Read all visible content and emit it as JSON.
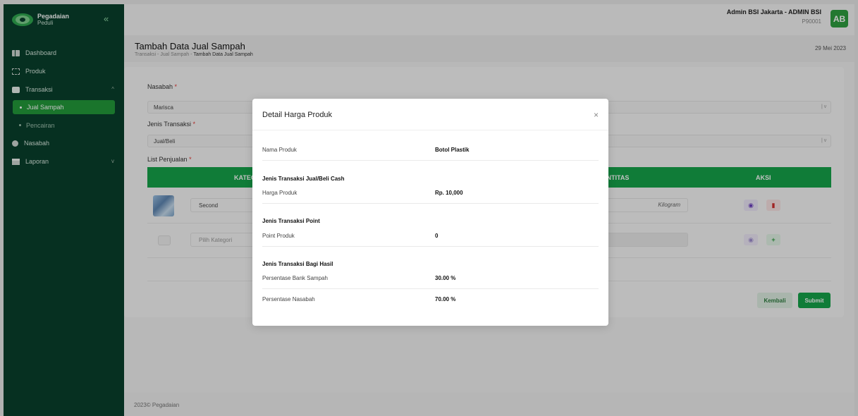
{
  "app": {
    "logo_name": "Pegadaian",
    "logo_sub": "Peduli",
    "collapse_icon": "«"
  },
  "sidebar": {
    "items": [
      {
        "label": "Dashboard",
        "icon": "dashboard-icon"
      },
      {
        "label": "Produk",
        "icon": "product-icon"
      },
      {
        "label": "Transaksi",
        "icon": "wallet-icon",
        "expanded": true
      },
      {
        "label": "Jual Sampah",
        "active": true
      },
      {
        "label": "Pencairan"
      },
      {
        "label": "Nasabah",
        "icon": "user-icon"
      },
      {
        "label": "Laporan",
        "icon": "calendar-icon"
      }
    ]
  },
  "header": {
    "user_name": "Admin BSI Jakarta - ADMIN BSI",
    "user_id": "P90001",
    "avatar": "AB"
  },
  "page": {
    "title": "Tambah Data Jual Sampah",
    "breadcrumb": [
      "Transaksi",
      "Jual Sampah",
      "Tambah Data Jual Sampah"
    ],
    "breadcrumb_sep": "-",
    "date": "29 Mei 2023"
  },
  "form": {
    "nasabah_label": "Nasabah",
    "nasabah_value": "Marisca",
    "jenis_label": "Jenis Transaksi",
    "jenis_value": "Jual/Beli",
    "list_label": "List Penjualan",
    "required_mark": "*",
    "table_headers": {
      "kategori": "KATEGORI",
      "kuantitas": "KUANTITAS",
      "aksi": "AKSI"
    },
    "rows": [
      {
        "kategori": "Second",
        "unit": "Kilogram"
      },
      {
        "kategori": "Pilih Kategori",
        "unit": ""
      }
    ],
    "back_label": "Kembali",
    "submit_label": "Submit"
  },
  "footer": {
    "text": "2023© Pegadaian"
  },
  "modal": {
    "title": "Detail Harga Produk",
    "close": "×",
    "nama_produk_label": "Nama Produk",
    "nama_produk_value": "Botol Plastik",
    "sections": [
      {
        "title": "Jenis Transaksi Jual/Beli Cash",
        "rows": [
          {
            "label": "Harga Produk",
            "value": "Rp. 10,000"
          }
        ]
      },
      {
        "title": "Jenis Transaksi Point",
        "rows": [
          {
            "label": "Point Produk",
            "value": "0"
          }
        ]
      },
      {
        "title": "Jenis Transaksi Bagi Hasil",
        "rows": [
          {
            "label": "Persentase Bank Sampah",
            "value": "30.00 %"
          },
          {
            "label": "Persentase Nasabah",
            "value": "70.00 %"
          }
        ]
      }
    ]
  },
  "colors": {
    "sidebar": "#08402c",
    "accent": "#16a34a",
    "danger": "#d32f2f"
  }
}
